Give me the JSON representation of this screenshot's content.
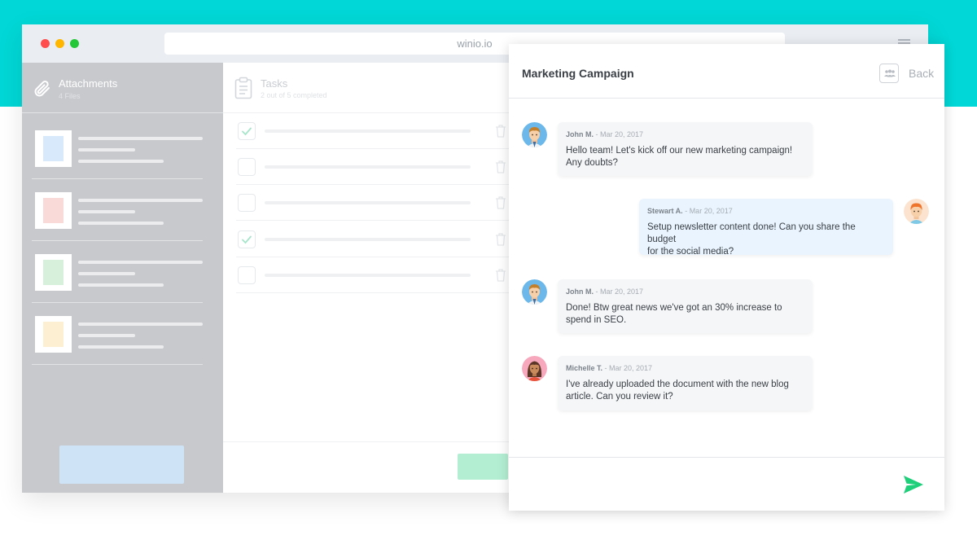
{
  "browser": {
    "url": "winio.io"
  },
  "attachments": {
    "title": "Attachments",
    "subtitle": "4 Files",
    "files": [
      {
        "doc_color": "#d8e9fb"
      },
      {
        "doc_color": "#fadad8"
      },
      {
        "doc_color": "#d7f0dc"
      },
      {
        "doc_color": "#fdf0d2"
      }
    ]
  },
  "tasks": {
    "title": "Tasks",
    "subtitle": "2 out of 5 completed",
    "items": [
      {
        "completed": true
      },
      {
        "completed": false
      },
      {
        "completed": false
      },
      {
        "completed": true
      },
      {
        "completed": false
      }
    ]
  },
  "chat": {
    "title": "Marketing Campaign",
    "back_label": "Back",
    "messages": [
      {
        "author": "John M.",
        "separator": " - ",
        "date": "Mar 20, 2017",
        "text_line1": "Hello team! Let's kick off our new marketing campaign!",
        "text_line2": "Any doubts?",
        "direction": "incoming",
        "avatar": "john-avatar"
      },
      {
        "author": "Stewart A.",
        "separator": " - ",
        "date": "Mar 20, 2017",
        "text_line1": "Setup newsletter content done! Can you share the budget",
        "text_line2": "for the social media?",
        "direction": "outgoing",
        "avatar": "stewart-avatar"
      },
      {
        "author": "John M.",
        "separator": " - ",
        "date": "Mar 20, 2017",
        "text_line1": "Done! Btw great news we've got an 30% increase to",
        "text_line2": "spend in SEO.",
        "direction": "incoming",
        "avatar": "john-avatar"
      },
      {
        "author": "Michelle T.",
        "separator": " - ",
        "date": "Mar 20, 2017",
        "text_line1": "I've already uploaded the document with the new blog",
        "text_line2": "article. Can you review it?",
        "direction": "incoming",
        "avatar": "michelle-avatar"
      }
    ]
  },
  "colors": {
    "accent_teal": "#00d7d6",
    "send_green": "#1fcf7a"
  }
}
